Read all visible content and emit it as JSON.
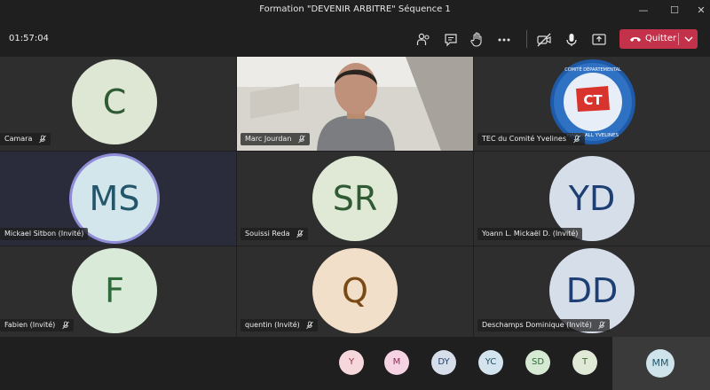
{
  "window": {
    "title": "Formation \"DEVENIR ARBITRE\" Séquence 1"
  },
  "window_controls": {
    "minimize": "—",
    "maximize": "☐",
    "close": "✕"
  },
  "toolbar": {
    "timer": "01:57:04",
    "quit_label": "Quitter"
  },
  "tiles": [
    {
      "initials": "C",
      "name": "Camara",
      "avatar_bg": "#dde7d3",
      "avatar_fg": "#2f5a33",
      "muted": true
    },
    {
      "name": "Marc Jourdan",
      "muted": true,
      "video": true
    },
    {
      "name": "TEC du Comité Yvelines",
      "muted": true,
      "logo": true,
      "logo_text_top": "COMITÉ DÉPARTEMENTAL",
      "logo_mark": "CT",
      "logo_text_bottom": "HANDBALL YVELINES"
    },
    {
      "initials": "MS",
      "name": "Mickael Sitbon (Invité)",
      "avatar_bg": "#d3e6ec",
      "avatar_fg": "#23566b",
      "speaking": true
    },
    {
      "initials": "SR",
      "name": "Souissi Reda",
      "avatar_bg": "#dfe9d6",
      "avatar_fg": "#2f5a33",
      "muted": true
    },
    {
      "initials": "YD",
      "name": "Yoann L. Mickaël D. (Invité)",
      "avatar_bg": "#d6deea",
      "avatar_fg": "#1e3f73"
    },
    {
      "initials": "F",
      "name": "Fabien (Invité)",
      "avatar_bg": "#d9ead9",
      "avatar_fg": "#2f6a3a",
      "muted": true
    },
    {
      "initials": "Q",
      "name": "quentin (Invité)",
      "avatar_bg": "#f2dfca",
      "avatar_fg": "#7a4a16",
      "muted": true
    },
    {
      "initials": "DD",
      "name": "Deschamps Dominique (Invité)",
      "avatar_bg": "#d6deea",
      "avatar_fg": "#1e3f73",
      "muted": true
    }
  ],
  "overflow": [
    {
      "initials": "Y",
      "bg": "#f6d8dc",
      "fg": "#9a2f3c"
    },
    {
      "initials": "M",
      "bg": "#f6d3e3",
      "fg": "#8f2c5c"
    },
    {
      "initials": "DY",
      "bg": "#d6deea",
      "fg": "#1e3f73"
    },
    {
      "initials": "YC",
      "bg": "#d3e4ee",
      "fg": "#1f4f6b"
    },
    {
      "initials": "SD",
      "bg": "#d6ead3",
      "fg": "#2f6a3a"
    },
    {
      "initials": "T",
      "bg": "#dfe9d6",
      "fg": "#3f6a2f"
    }
  ],
  "self": {
    "initials": "MM",
    "bg": "#cfe3ea",
    "fg": "#23566b"
  }
}
